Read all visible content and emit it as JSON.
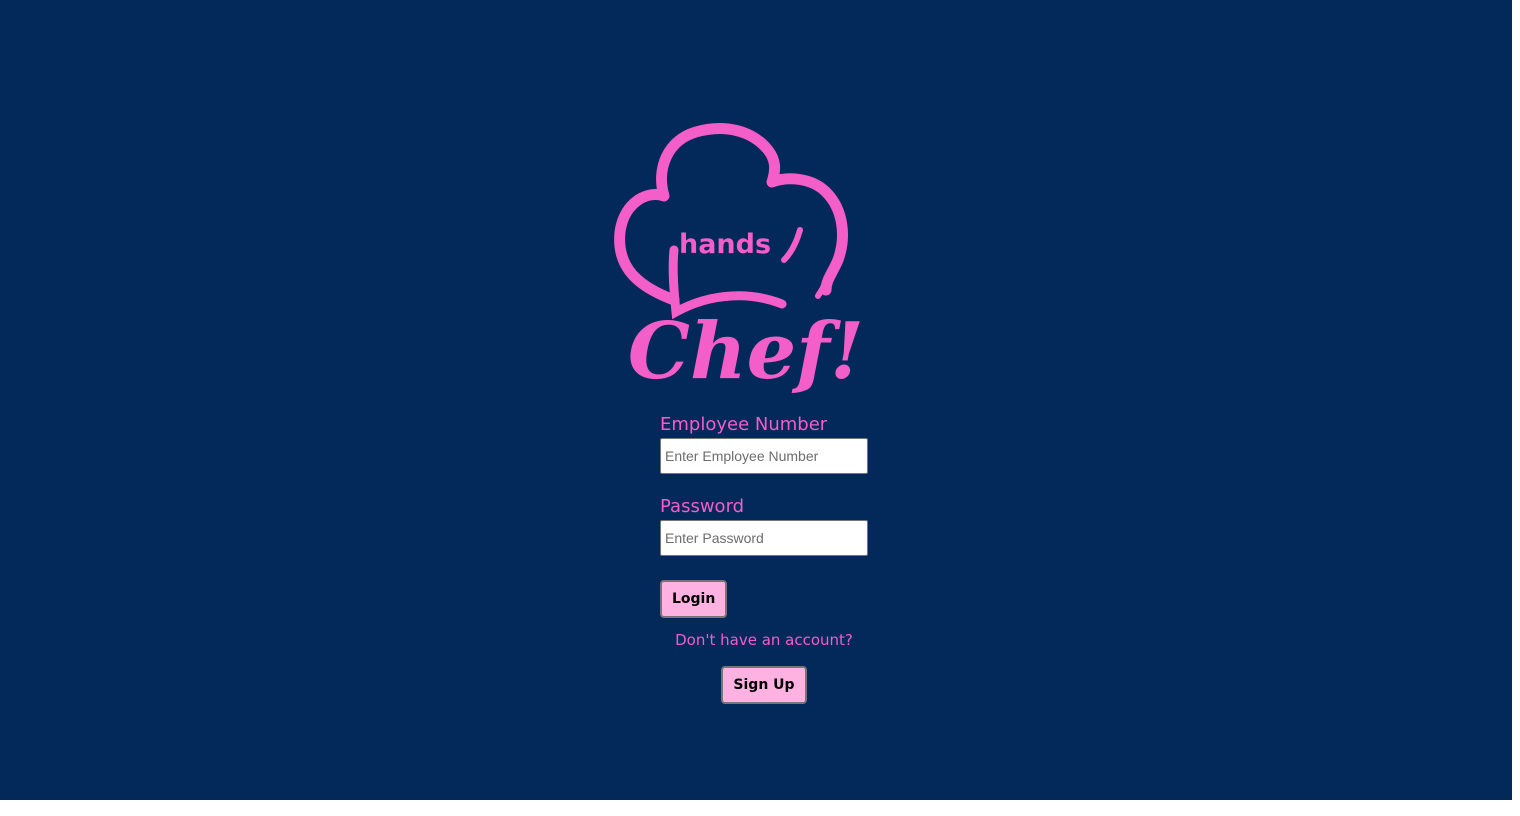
{
  "logo": {
    "text_top": "hands",
    "text_bottom": "Chef!",
    "color": "#f35ec9"
  },
  "colors": {
    "background": "#03285a",
    "accent": "#f35ec9",
    "button_bg": "#fdb2e2"
  },
  "form": {
    "employee_label": "Employee Number",
    "employee_placeholder": "Enter Employee Number",
    "employee_value": "",
    "password_label": "Password",
    "password_placeholder": "Enter Password",
    "password_value": "",
    "login_label": "Login"
  },
  "signup": {
    "prompt": "Don't have an account?",
    "button_label": "Sign Up"
  }
}
